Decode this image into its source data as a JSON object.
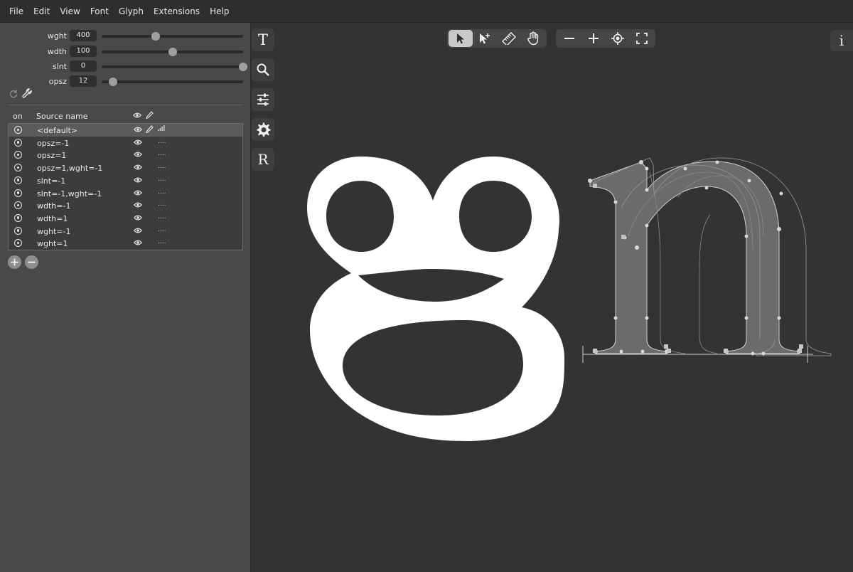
{
  "menu": [
    "File",
    "Edit",
    "View",
    "Font",
    "Glyph",
    "Extensions",
    "Help"
  ],
  "axes": [
    {
      "name": "wght",
      "value": "400",
      "position": 0.38
    },
    {
      "name": "wdth",
      "value": "100",
      "position": 0.5
    },
    {
      "name": "slnt",
      "value": "0",
      "position": 1.0
    },
    {
      "name": "opsz",
      "value": "12",
      "position": 0.08
    }
  ],
  "sources": {
    "header": {
      "on": "on",
      "name": "Source name"
    },
    "rows": [
      {
        "name": "<default>",
        "levels": "....",
        "selected": true
      },
      {
        "name": "opsz=-1",
        "levels": "....",
        "selected": false
      },
      {
        "name": "opsz=1",
        "levels": "....",
        "selected": false
      },
      {
        "name": "opsz=1,wght=-1",
        "levels": "....",
        "selected": false
      },
      {
        "name": "slnt=-1",
        "levels": "....",
        "selected": false
      },
      {
        "name": "slnt=-1,wght=-1",
        "levels": "....",
        "selected": false
      },
      {
        "name": "wdth=-1",
        "levels": "....",
        "selected": false
      },
      {
        "name": "wdth=1",
        "levels": "....",
        "selected": false
      },
      {
        "name": "wght=-1",
        "levels": "....",
        "selected": false
      },
      {
        "name": "wght=1",
        "levels": "....",
        "selected": false
      }
    ]
  },
  "side_tools": [
    {
      "name": "text-tool",
      "label": "T"
    },
    {
      "name": "search-tool",
      "label": ""
    },
    {
      "name": "designspace-tool",
      "label": ""
    },
    {
      "name": "settings-tool",
      "label": ""
    },
    {
      "name": "reference-font-tool",
      "label": "R"
    }
  ],
  "toolbar": {
    "tools": [
      "pointer-icon",
      "pen-icon",
      "ruler-icon",
      "hand-icon"
    ],
    "zoom": [
      "zoom-out-icon",
      "zoom-in-icon",
      "zoom-fit-icon",
      "fullscreen-icon"
    ]
  },
  "info_label": "i",
  "colors": {
    "background": "#333333",
    "panel": "#494949",
    "glyph_fill": "#ffffff",
    "accent": "#c9c9c9"
  }
}
